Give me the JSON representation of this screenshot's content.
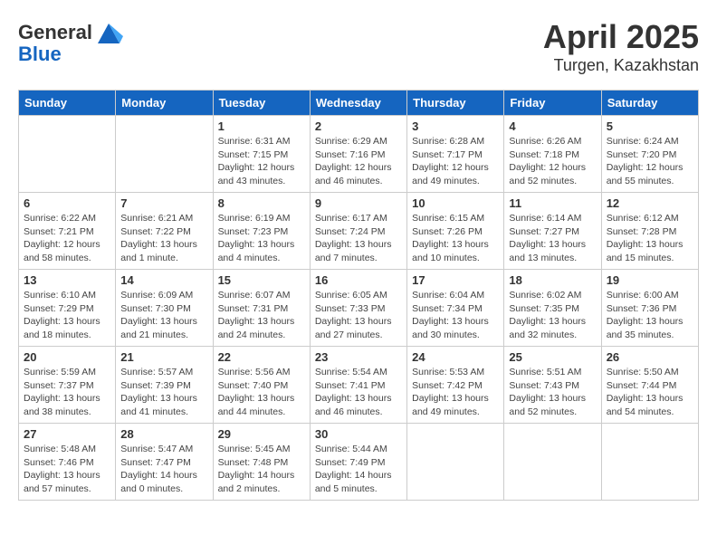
{
  "header": {
    "logo_general": "General",
    "logo_blue": "Blue",
    "month_year": "April 2025",
    "location": "Turgen, Kazakhstan"
  },
  "weekdays": [
    "Sunday",
    "Monday",
    "Tuesday",
    "Wednesday",
    "Thursday",
    "Friday",
    "Saturday"
  ],
  "weeks": [
    [
      {
        "day": "",
        "info": ""
      },
      {
        "day": "",
        "info": ""
      },
      {
        "day": "1",
        "info": "Sunrise: 6:31 AM\nSunset: 7:15 PM\nDaylight: 12 hours and 43 minutes."
      },
      {
        "day": "2",
        "info": "Sunrise: 6:29 AM\nSunset: 7:16 PM\nDaylight: 12 hours and 46 minutes."
      },
      {
        "day": "3",
        "info": "Sunrise: 6:28 AM\nSunset: 7:17 PM\nDaylight: 12 hours and 49 minutes."
      },
      {
        "day": "4",
        "info": "Sunrise: 6:26 AM\nSunset: 7:18 PM\nDaylight: 12 hours and 52 minutes."
      },
      {
        "day": "5",
        "info": "Sunrise: 6:24 AM\nSunset: 7:20 PM\nDaylight: 12 hours and 55 minutes."
      }
    ],
    [
      {
        "day": "6",
        "info": "Sunrise: 6:22 AM\nSunset: 7:21 PM\nDaylight: 12 hours and 58 minutes."
      },
      {
        "day": "7",
        "info": "Sunrise: 6:21 AM\nSunset: 7:22 PM\nDaylight: 13 hours and 1 minute."
      },
      {
        "day": "8",
        "info": "Sunrise: 6:19 AM\nSunset: 7:23 PM\nDaylight: 13 hours and 4 minutes."
      },
      {
        "day": "9",
        "info": "Sunrise: 6:17 AM\nSunset: 7:24 PM\nDaylight: 13 hours and 7 minutes."
      },
      {
        "day": "10",
        "info": "Sunrise: 6:15 AM\nSunset: 7:26 PM\nDaylight: 13 hours and 10 minutes."
      },
      {
        "day": "11",
        "info": "Sunrise: 6:14 AM\nSunset: 7:27 PM\nDaylight: 13 hours and 13 minutes."
      },
      {
        "day": "12",
        "info": "Sunrise: 6:12 AM\nSunset: 7:28 PM\nDaylight: 13 hours and 15 minutes."
      }
    ],
    [
      {
        "day": "13",
        "info": "Sunrise: 6:10 AM\nSunset: 7:29 PM\nDaylight: 13 hours and 18 minutes."
      },
      {
        "day": "14",
        "info": "Sunrise: 6:09 AM\nSunset: 7:30 PM\nDaylight: 13 hours and 21 minutes."
      },
      {
        "day": "15",
        "info": "Sunrise: 6:07 AM\nSunset: 7:31 PM\nDaylight: 13 hours and 24 minutes."
      },
      {
        "day": "16",
        "info": "Sunrise: 6:05 AM\nSunset: 7:33 PM\nDaylight: 13 hours and 27 minutes."
      },
      {
        "day": "17",
        "info": "Sunrise: 6:04 AM\nSunset: 7:34 PM\nDaylight: 13 hours and 30 minutes."
      },
      {
        "day": "18",
        "info": "Sunrise: 6:02 AM\nSunset: 7:35 PM\nDaylight: 13 hours and 32 minutes."
      },
      {
        "day": "19",
        "info": "Sunrise: 6:00 AM\nSunset: 7:36 PM\nDaylight: 13 hours and 35 minutes."
      }
    ],
    [
      {
        "day": "20",
        "info": "Sunrise: 5:59 AM\nSunset: 7:37 PM\nDaylight: 13 hours and 38 minutes."
      },
      {
        "day": "21",
        "info": "Sunrise: 5:57 AM\nSunset: 7:39 PM\nDaylight: 13 hours and 41 minutes."
      },
      {
        "day": "22",
        "info": "Sunrise: 5:56 AM\nSunset: 7:40 PM\nDaylight: 13 hours and 44 minutes."
      },
      {
        "day": "23",
        "info": "Sunrise: 5:54 AM\nSunset: 7:41 PM\nDaylight: 13 hours and 46 minutes."
      },
      {
        "day": "24",
        "info": "Sunrise: 5:53 AM\nSunset: 7:42 PM\nDaylight: 13 hours and 49 minutes."
      },
      {
        "day": "25",
        "info": "Sunrise: 5:51 AM\nSunset: 7:43 PM\nDaylight: 13 hours and 52 minutes."
      },
      {
        "day": "26",
        "info": "Sunrise: 5:50 AM\nSunset: 7:44 PM\nDaylight: 13 hours and 54 minutes."
      }
    ],
    [
      {
        "day": "27",
        "info": "Sunrise: 5:48 AM\nSunset: 7:46 PM\nDaylight: 13 hours and 57 minutes."
      },
      {
        "day": "28",
        "info": "Sunrise: 5:47 AM\nSunset: 7:47 PM\nDaylight: 14 hours and 0 minutes."
      },
      {
        "day": "29",
        "info": "Sunrise: 5:45 AM\nSunset: 7:48 PM\nDaylight: 14 hours and 2 minutes."
      },
      {
        "day": "30",
        "info": "Sunrise: 5:44 AM\nSunset: 7:49 PM\nDaylight: 14 hours and 5 minutes."
      },
      {
        "day": "",
        "info": ""
      },
      {
        "day": "",
        "info": ""
      },
      {
        "day": "",
        "info": ""
      }
    ]
  ]
}
